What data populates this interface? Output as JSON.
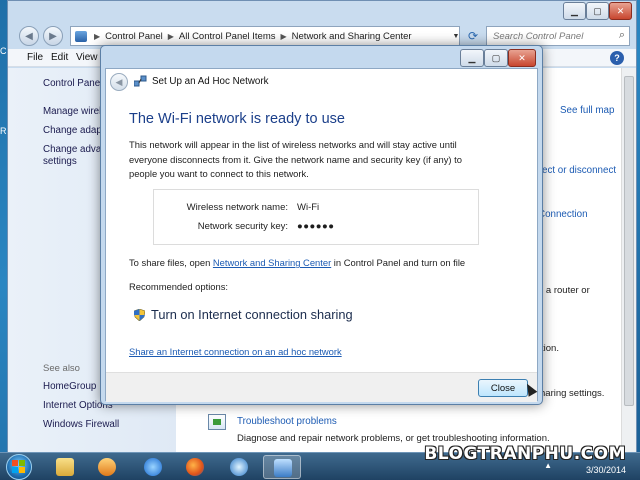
{
  "desktop": {
    "left_fragment_1": "C",
    "left_fragment_2": "R"
  },
  "explorer": {
    "address": {
      "crumbs": [
        "Control Panel",
        "All Control Panel Items",
        "Network and Sharing Center"
      ]
    },
    "search_placeholder": "Search Control Panel",
    "menu": {
      "file": "File",
      "edit": "Edit",
      "view": "View"
    },
    "help_glyph": "?",
    "sidebar": {
      "home": "Control Panel",
      "manage_wireless": "Manage wireless networks",
      "change_adapter": "Change adapter settings",
      "change_advanced_1": "Change advanced sharing",
      "change_advanced_2": "settings",
      "see_also": "See also",
      "homegroup": "HomeGroup",
      "internet_options": "Internet Options",
      "windows_firewall": "Windows Firewall"
    },
    "main": {
      "see_full_map": "See full map",
      "connect_disconnect": "ect or disconnect",
      "connection": "Connection",
      "router_or": "o a router or",
      "tion": "tion.",
      "sharing_settings": "haring settings.",
      "troubleshoot": "Troubleshoot problems",
      "troubleshoot_desc": "Diagnose and repair network problems, or get troubleshooting information."
    }
  },
  "dialog": {
    "title": "Set Up an Ad Hoc Network",
    "heading": "The Wi-Fi network is ready to use",
    "description": "This network will appear in the list of wireless networks and will stay active until everyone disconnects from it. Give the network name and security key (if any) to people you want to connect to this network.",
    "network_name_label": "Wireless network name:",
    "network_name_value": "Wi-Fi",
    "security_key_label": "Network security key:",
    "security_key_value": "●●●●●●",
    "share_prefix": "To share files, open ",
    "share_link": "Network and Sharing Center",
    "share_suffix": " in Control Panel and turn on file",
    "recommended_label": "Recommended options:",
    "ics_option": "Turn on Internet connection sharing",
    "share_adhoc_link": "Share an Internet connection on an ad hoc network",
    "close_label": "Close"
  },
  "taskbar": {
    "date": "3/30/2014",
    "watermark": "BLOGTRANPHU.COM",
    "tray_arrow": "▲"
  }
}
